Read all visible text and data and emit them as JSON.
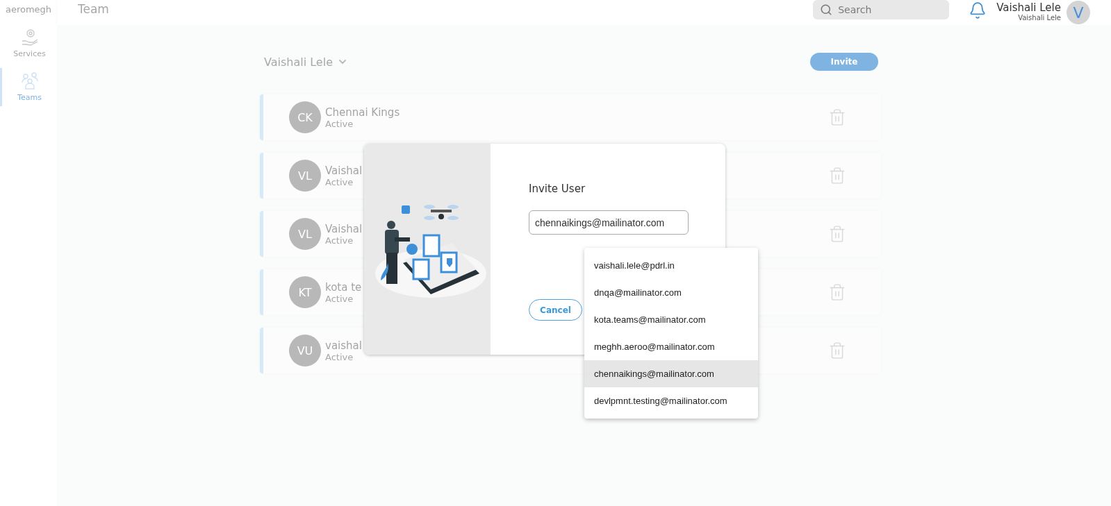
{
  "sidebar": {
    "logo": "aeromegh",
    "items": [
      {
        "label": "Services",
        "kind": "services",
        "selected": false
      },
      {
        "label": "Teams",
        "kind": "teams",
        "selected": true
      }
    ]
  },
  "header": {
    "title": "Team",
    "search": {
      "placeholder": "Search"
    },
    "user": {
      "name": "Vaishali Lele",
      "subtitle": "Vaishali Lele",
      "initial": "V"
    }
  },
  "team_selector": {
    "label": "Vaishali Lele"
  },
  "invite_button": "Invite",
  "members": [
    {
      "initials": "CK",
      "name": "Chennai Kings",
      "status": "Active"
    },
    {
      "initials": "VL",
      "name": "Vaishal",
      "status": "Active"
    },
    {
      "initials": "VL",
      "name": "Vaishal",
      "status": "Active"
    },
    {
      "initials": "KT",
      "name": "kota te",
      "status": "Active"
    },
    {
      "initials": "VU",
      "name": "vaishal",
      "status": "Active"
    }
  ],
  "dialog": {
    "title": "Invite User",
    "email": {
      "value": "chennaikings@mailinator.com"
    },
    "cancel": "Cancel",
    "suggestions": [
      {
        "label": "vaishali.lele@pdrl.in",
        "selected": false
      },
      {
        "label": "dnqa@mailinator.com",
        "selected": false
      },
      {
        "label": "kota.teams@mailinator.com",
        "selected": false
      },
      {
        "label": "meghh.aeroo@mailinator.com",
        "selected": false
      },
      {
        "label": "chennaikings@mailinator.com",
        "selected": true
      },
      {
        "label": "devlpmnt.testing@mailinator.com",
        "selected": false
      }
    ]
  }
}
